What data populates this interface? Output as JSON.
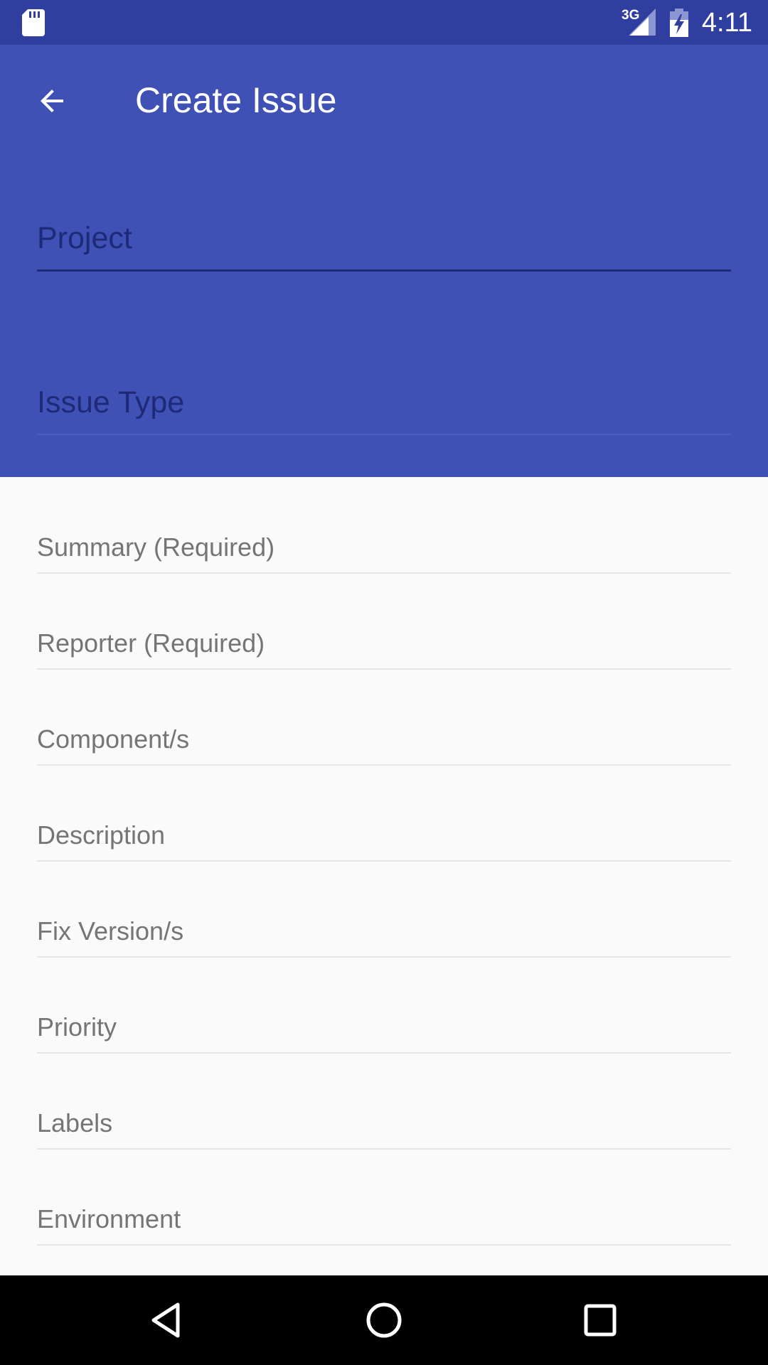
{
  "status_bar": {
    "network": "3G",
    "time": "4:11",
    "icons": [
      "sd-card-icon",
      "signal-icon",
      "battery-charging-icon"
    ]
  },
  "header": {
    "title": "Create Issue",
    "back_icon": "arrow-back-icon",
    "project_hint": "Project",
    "issue_type_hint": "Issue Type",
    "background": "#3F51B5",
    "status_background": "#303F9F"
  },
  "form": {
    "fields": [
      {
        "hint": "Summary (Required)"
      },
      {
        "hint": "Reporter (Required)"
      },
      {
        "hint": "Component/s"
      },
      {
        "hint": "Description"
      },
      {
        "hint": "Fix Version/s"
      },
      {
        "hint": "Priority"
      },
      {
        "hint": "Labels"
      },
      {
        "hint": "Environment"
      }
    ]
  },
  "nav_bar": {
    "icons": [
      "nav-back-icon",
      "nav-home-icon",
      "nav-recents-icon"
    ]
  }
}
